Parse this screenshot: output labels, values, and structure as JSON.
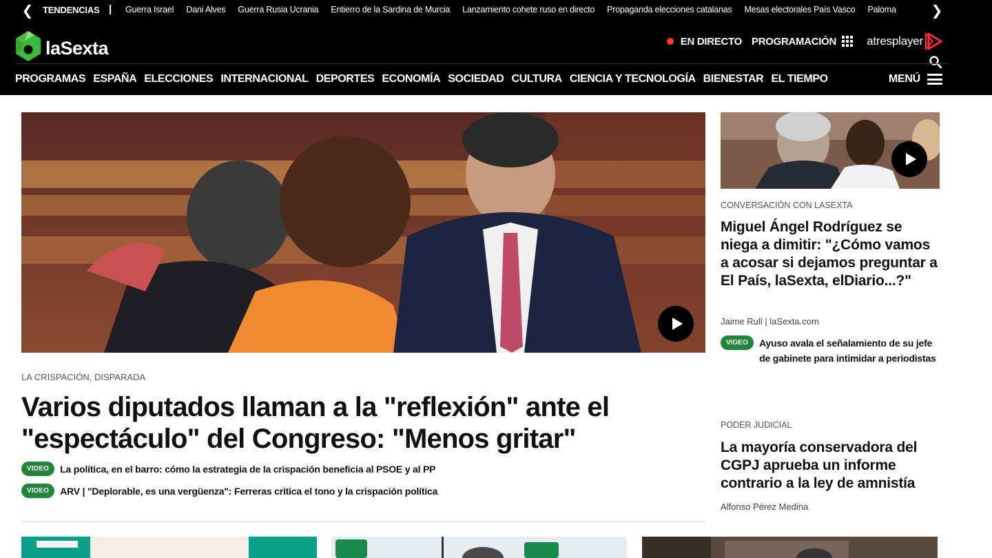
{
  "trending": {
    "label": "TENDENCIAS",
    "separator": "|",
    "items": [
      "Guerra Israel",
      "Dani Alves",
      "Guerra Rusia Ucrania",
      "Entierro de la Sardina de Murcia",
      "Lanzamiento cohete ruso en directo",
      "Propaganda elecciones catalanas",
      "Mesas electorales País Vasco",
      "Paloma"
    ]
  },
  "header": {
    "logo_text": "laSexta",
    "live_label": "EN DIRECTO",
    "programacion_label": "PROGRAMACIÓN",
    "atresplayer_label": "atresplayer",
    "menu_label": "MENÚ",
    "nav": [
      "PROGRAMAS",
      "ESPAÑA",
      "ELECCIONES",
      "INTERNACIONAL",
      "DEPORTES",
      "ECONOMÍA",
      "SOCIEDAD",
      "CULTURA",
      "CIENCIA Y TECNOLOGÍA",
      "BIENESTAR",
      "EL TIEMPO"
    ]
  },
  "colors": {
    "brand_green": "#3dbb3a",
    "live_red": "#ff3b2b",
    "badge_green": "#22863a",
    "atres_red": "#ff2a3a"
  },
  "main": {
    "kicker": "LA CRISPACIÓN, DISPARADA",
    "title": "Varios diputados llaman a la \"reflexión\" ante el \"espectáculo\" del Congreso: \"Menos gritar\"",
    "related": [
      {
        "badge": "VIDEO",
        "text": "La política, en el barro: cómo la estrategia de la crispación beneficia al PSOE y al PP"
      },
      {
        "badge": "VIDEO",
        "text": "ARV | \"Deplorable, es una vergüenza\": Ferreras critica el tono y la crispación política"
      }
    ]
  },
  "sidebar": {
    "story1": {
      "kicker": "CONVERSACIÓN CON LASEXTA",
      "title": "Miguel Ángel Rodríguez se niega a dimitir: \"¿Cómo vamos a acosar si dejamos preguntar a El País, laSexta, elDiario...?\"",
      "author": "Jaime Rull | laSexta.com",
      "related_badge": "VIDEO",
      "related_text": "Ayuso avala el señalamiento de su jefe de gabinete para intimidar a periodistas"
    },
    "story2": {
      "kicker": "PODER JUDICIAL",
      "title": "La mayoría conservadora del CGPJ aprueba un informe contrario a la ley de amnistía",
      "author": "Alfonso Pérez Medina"
    }
  }
}
